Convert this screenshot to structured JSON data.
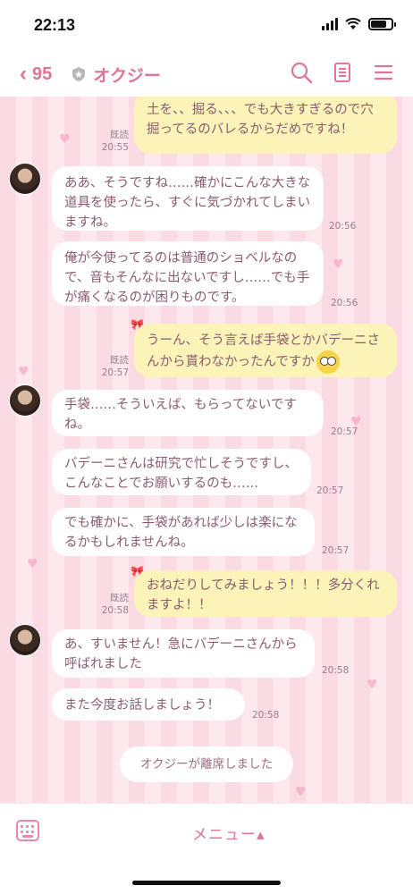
{
  "status_bar": {
    "time": "22:13"
  },
  "header": {
    "back_count": "95",
    "title": "オクジー",
    "icons": [
      "search-icon",
      "notes-icon",
      "menu-icon"
    ]
  },
  "messages": [
    {
      "side": "out",
      "text": "土を、、掘る、、、でも大きすぎるので穴掘ってるのバレるからだめですね！",
      "read": "既読",
      "time": "20:55"
    },
    {
      "side": "in",
      "text": "ああ、そうですね……確かにこんな大きな道具を使ったら、すぐに気づかれてしまいますね。",
      "time": "20:56"
    },
    {
      "side": "in",
      "text": "俺が今使ってるのは普通のショベルなので、音もそんなに出ないですし……でも手が痛くなるのが困りものです。",
      "time": "20:56"
    },
    {
      "side": "out",
      "text": "うーん、そう言えば手袋とかバデーニさんから貰わなかったんですか",
      "read": "既読",
      "time": "20:57"
    },
    {
      "side": "in",
      "text": "手袋……そういえば、もらってないですね。",
      "time": "20:57"
    },
    {
      "side": "in",
      "text": "バデーニさんは研究で忙しそうですし、こんなことでお願いするのも……",
      "time": "20:57"
    },
    {
      "side": "in",
      "text": "でも確かに、手袋があれば少しは楽になるかもしれませんね。",
      "time": "20:57"
    },
    {
      "side": "out",
      "text": "おねだりしてみましょう！！！多分くれますよ！！",
      "read": "既読",
      "time": "20:58"
    },
    {
      "side": "in",
      "text": "あ、すいません！急にバデーニさんから呼ばれました",
      "time": "20:58"
    },
    {
      "side": "in",
      "text": "また今度お話しましょう！",
      "time": "20:58"
    }
  ],
  "system_message": "オクジーが離席しました",
  "bottom_bar": {
    "menu_label": "メニュー▴"
  },
  "colors": {
    "accent": "#e0739a",
    "incoming_bubble": "#ffffff",
    "outgoing_bubble": "#fbf3b7",
    "background_stripe_a": "#fadbe4",
    "background_stripe_b": "#fde8ee"
  }
}
